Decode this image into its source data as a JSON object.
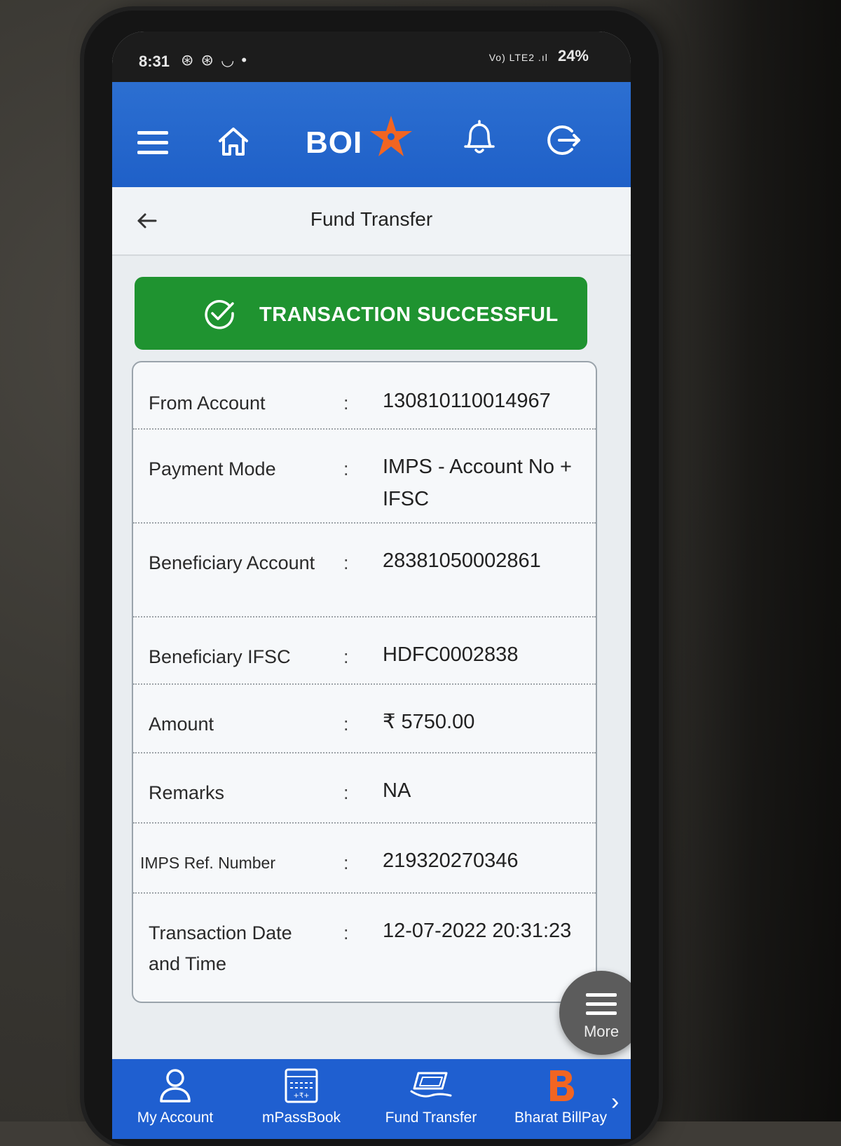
{
  "status_bar": {
    "time": "8:31",
    "left_icons": "⊛ ⊛ ◡ •",
    "signal_text": "Vo) LTE2 .ıl",
    "battery": "24%"
  },
  "app_bar": {
    "logo_text": "BOI",
    "icons": [
      "menu-icon",
      "home-icon",
      "bell-icon",
      "logout-icon"
    ]
  },
  "page": {
    "title": "Fund Transfer"
  },
  "banner": {
    "text": "TRANSACTION SUCCESSFUL",
    "color": "#1f9330"
  },
  "details": [
    {
      "label": "From Account",
      "value": "130810110014967"
    },
    {
      "label": "Payment Mode",
      "value": "IMPS - Account No + IFSC"
    },
    {
      "label": "Beneficiary Account",
      "value": "28381050002861"
    },
    {
      "label": "Beneficiary IFSC",
      "value": "HDFC0002838"
    },
    {
      "label": "Amount",
      "value": "₹ 5750.00"
    },
    {
      "label": "Remarks",
      "value": "NA"
    },
    {
      "label": "IMPS Ref. Number",
      "value": "219320270346"
    },
    {
      "label": "Transaction Date and Time",
      "value": "12-07-2022 20:31:23"
    }
  ],
  "colon": ":",
  "fab": {
    "label": "More"
  },
  "bottom_nav": [
    {
      "label": "My Account",
      "icon": "user-icon"
    },
    {
      "label": "mPassBook",
      "icon": "passbook-icon"
    },
    {
      "label": "Fund Transfer",
      "icon": "transfer-icon"
    },
    {
      "label": "Bharat BillPay",
      "icon": "bharat-billpay-icon"
    }
  ],
  "colors": {
    "brand_blue": "#1f60c8",
    "success_green": "#1f9330",
    "star_orange": "#f26522"
  }
}
